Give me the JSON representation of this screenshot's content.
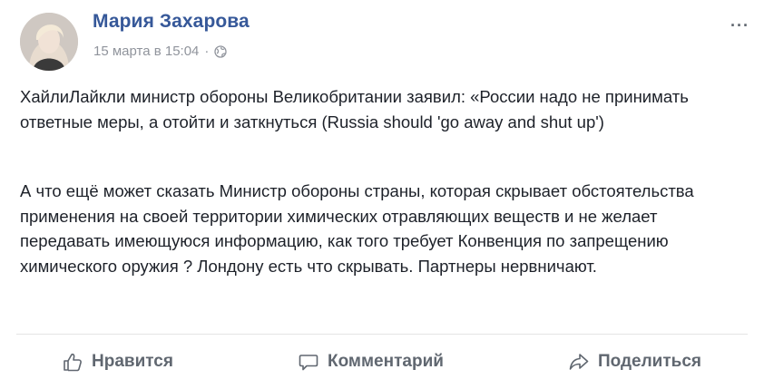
{
  "post": {
    "author": "Мария Захарова",
    "timestamp": "15 марта в 15:04",
    "separator": "·",
    "privacy_icon": "globe-icon",
    "more_label": "···",
    "paragraphs": [
      "ХайлиЛайкли министр обороны Великобритании заявил: «России надо не принимать ответные меры, а отойти и заткнуться (Russia should 'go away and shut up')",
      "А что ещё может сказать Министр обороны страны, которая скрывает обстоятельства применения на своей территории химических отравляющих веществ и не желает передавать имеющуюся информацию, как того требует Конвенция по запрещению химического оружия ? Лондону есть что скрывать. Партнеры нервничают."
    ]
  },
  "actions": {
    "like": {
      "label": "Нравится",
      "icon": "thumbs-up-icon"
    },
    "comment": {
      "label": "Комментарий",
      "icon": "comment-icon"
    },
    "share": {
      "label": "Поделиться",
      "icon": "share-icon"
    }
  },
  "colors": {
    "author_link": "#365899",
    "meta_text": "#90949c",
    "action_text": "#606770",
    "body_text": "#1d2129"
  }
}
